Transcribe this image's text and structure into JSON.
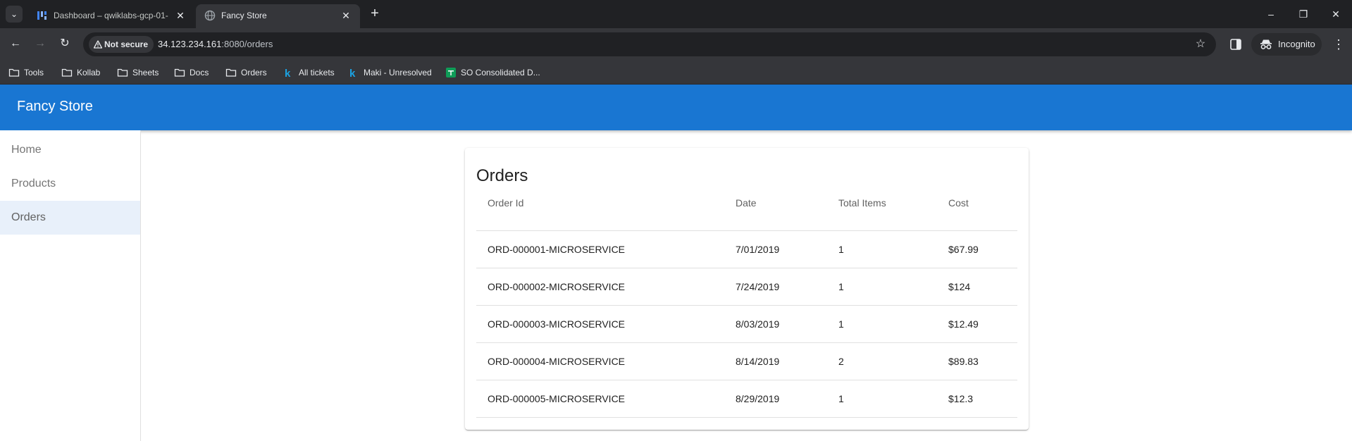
{
  "browser": {
    "tabs": [
      {
        "title": "Dashboard – qwiklabs-gcp-01-",
        "active": false,
        "icon": "dashboard-icon"
      },
      {
        "title": "Fancy Store",
        "active": true,
        "icon": "globe-icon"
      }
    ],
    "address": {
      "security_label": "Not secure",
      "host": "34.123.234.161",
      "path": ":8080/orders"
    },
    "profile_label": "Incognito",
    "bookmarks": [
      {
        "label": "Tools",
        "icon": "folder-icon"
      },
      {
        "label": "Kollab",
        "icon": "folder-icon"
      },
      {
        "label": "Sheets",
        "icon": "folder-icon"
      },
      {
        "label": "Docs",
        "icon": "folder-icon"
      },
      {
        "label": "Orders",
        "icon": "folder-icon"
      },
      {
        "label": "All tickets",
        "icon": "k-logo-icon"
      },
      {
        "label": "Maki - Unresolved",
        "icon": "k-logo-icon"
      },
      {
        "label": "SO Consolidated D...",
        "icon": "sheets-icon"
      }
    ]
  },
  "app": {
    "title": "Fancy Store",
    "brand_color": "#1976d2",
    "nav": [
      {
        "label": "Home",
        "active": false
      },
      {
        "label": "Products",
        "active": false
      },
      {
        "label": "Orders",
        "active": true
      }
    ]
  },
  "orders": {
    "title": "Orders",
    "columns": [
      "Order Id",
      "Date",
      "Total Items",
      "Cost"
    ],
    "rows": [
      [
        "ORD-000001-MICROSERVICE",
        "7/01/2019",
        "1",
        "$67.99"
      ],
      [
        "ORD-000002-MICROSERVICE",
        "7/24/2019",
        "1",
        "$124"
      ],
      [
        "ORD-000003-MICROSERVICE",
        "8/03/2019",
        "1",
        "$12.49"
      ],
      [
        "ORD-000004-MICROSERVICE",
        "8/14/2019",
        "2",
        "$89.83"
      ],
      [
        "ORD-000005-MICROSERVICE",
        "8/29/2019",
        "1",
        "$12.3"
      ]
    ]
  }
}
